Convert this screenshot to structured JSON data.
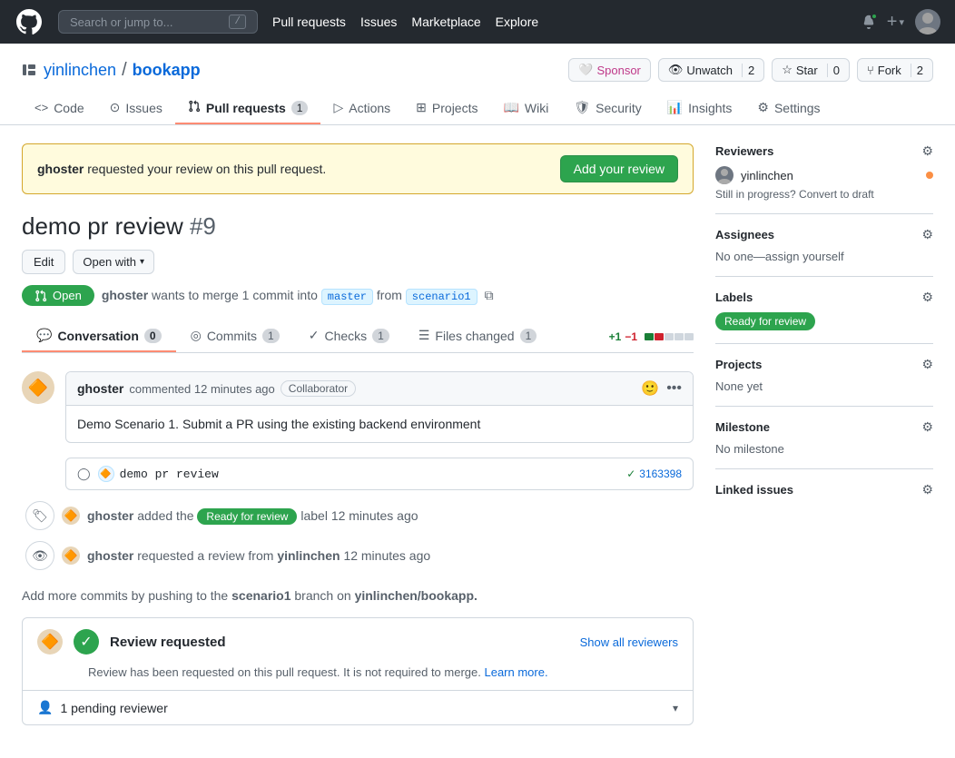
{
  "topnav": {
    "search_placeholder": "Search or jump to...",
    "search_shortcut": "/",
    "links": [
      "Pull requests",
      "Issues",
      "Marketplace",
      "Explore"
    ],
    "logo_alt": "GitHub"
  },
  "repo": {
    "owner": "yinlinchen",
    "name": "bookapp",
    "breadcrumb_sep": "/",
    "actions": {
      "sponsor_label": "Sponsor",
      "unwatch_label": "Unwatch",
      "unwatch_count": "2",
      "star_label": "Star",
      "star_count": "0",
      "fork_label": "Fork",
      "fork_count": "2"
    }
  },
  "repo_nav": {
    "tabs": [
      {
        "label": "Code",
        "icon": "code-icon",
        "active": false
      },
      {
        "label": "Issues",
        "icon": "issues-icon",
        "active": false
      },
      {
        "label": "Pull requests",
        "icon": "pr-icon",
        "badge": "1",
        "active": true
      },
      {
        "label": "Actions",
        "icon": "actions-icon",
        "active": false
      },
      {
        "label": "Projects",
        "icon": "projects-icon",
        "active": false
      },
      {
        "label": "Wiki",
        "icon": "wiki-icon",
        "active": false
      },
      {
        "label": "Security",
        "icon": "security-icon",
        "active": false
      },
      {
        "label": "Insights",
        "icon": "insights-icon",
        "active": false
      },
      {
        "label": "Settings",
        "icon": "settings-icon",
        "active": false
      }
    ]
  },
  "alert": {
    "text_prefix": "ghoster",
    "text_main": " requested your review on this pull request.",
    "button_label": "Add your review"
  },
  "pr": {
    "title": "demo pr review",
    "number": "#9",
    "status": "Open",
    "author": "ghoster",
    "merge_text": "wants to merge 1 commit into",
    "base_branch": "master",
    "from_text": "from",
    "head_branch": "scenario1",
    "edit_label": "Edit",
    "open_with_label": "Open with"
  },
  "pr_tabs": {
    "tabs": [
      {
        "label": "Conversation",
        "icon": "conversation-icon",
        "badge": "0",
        "active": true
      },
      {
        "label": "Commits",
        "icon": "commits-icon",
        "badge": "1",
        "active": false
      },
      {
        "label": "Checks",
        "icon": "checks-icon",
        "badge": "1",
        "active": false
      },
      {
        "label": "Files changed",
        "icon": "files-icon",
        "badge": "1",
        "active": false
      }
    ],
    "diff_add": "+1",
    "diff_del": "−1"
  },
  "comment": {
    "author": "ghoster",
    "timestamp": "commented 12 minutes ago",
    "badge": "Collaborator",
    "body": "Demo Scenario 1. Submit a PR using the existing backend environment"
  },
  "commit": {
    "icon_title": "demo pr review",
    "hash": "3163398",
    "check_label": "✓"
  },
  "label_event": {
    "author": "ghoster",
    "action": "added the",
    "label": "Ready for review",
    "suffix": "label 12 minutes ago"
  },
  "review_event": {
    "author": "ghoster",
    "action": "requested a review from",
    "reviewer": "yinlinchen",
    "suffix": "12 minutes ago"
  },
  "add_commits_msg": "Add more commits by pushing to the",
  "branch_name": "scenario1",
  "branch_suffix": "branch on",
  "repo_full": "yinlinchen/bookapp.",
  "review_section": {
    "title": "Review requested",
    "description": "Review has been requested on this pull request. It is not required to merge.",
    "learn_more": "Learn more.",
    "show_all": "Show all reviewers",
    "pending_label": "1 pending reviewer"
  },
  "sidebar": {
    "reviewers_label": "Reviewers",
    "reviewer_name": "yinlinchen",
    "reviewer_status": "Still in progress? Convert to draft",
    "assignees_label": "Assignees",
    "assignees_none": "No one—assign yourself",
    "labels_label": "Labels",
    "label_tag": "Ready for review",
    "projects_label": "Projects",
    "projects_none": "None yet",
    "milestone_label": "Milestone",
    "milestone_none": "No milestone",
    "linked_issues_label": "Linked issues"
  }
}
